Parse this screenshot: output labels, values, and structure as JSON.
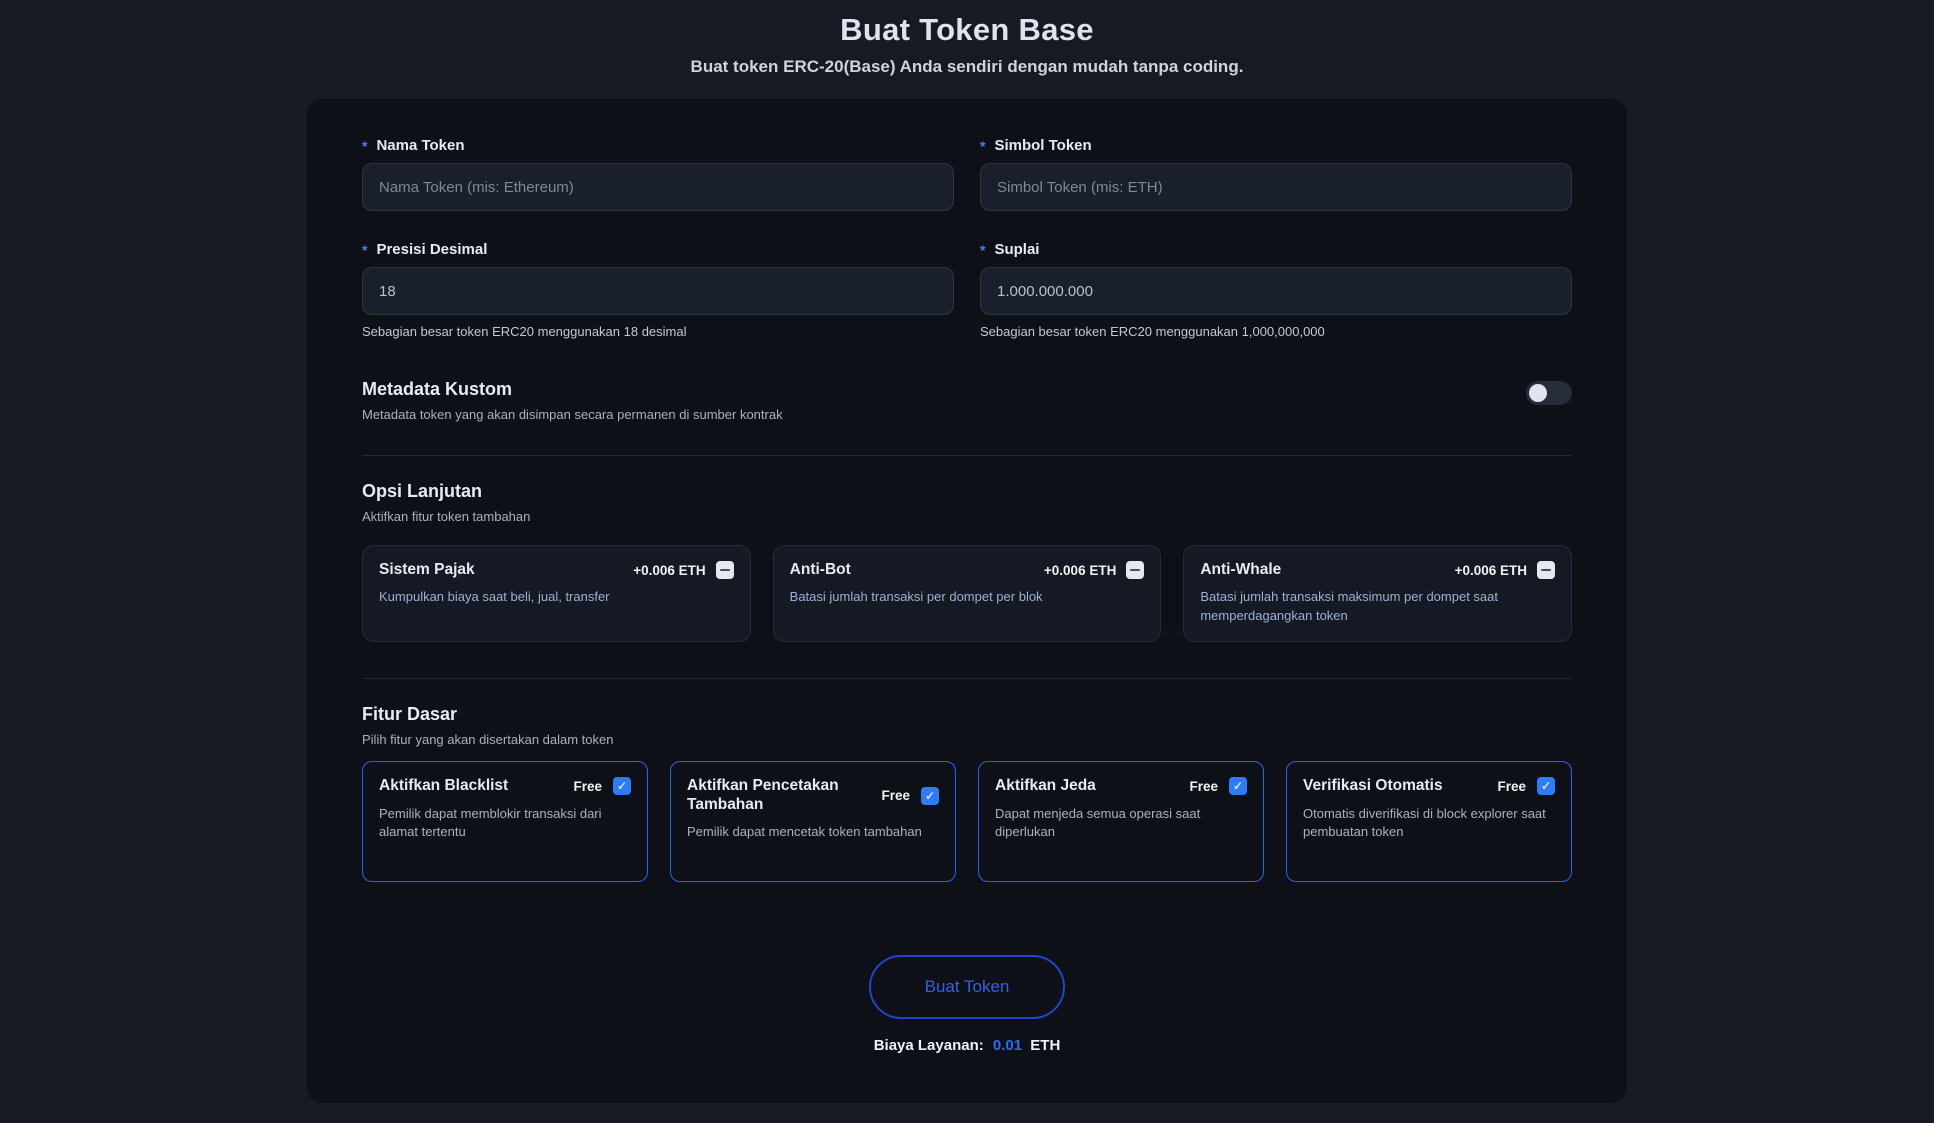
{
  "page": {
    "title": "Buat Token Base",
    "subtitle": "Buat token ERC-20(Base) Anda sendiri dengan mudah tanpa coding."
  },
  "icons": {
    "minus": "",
    "check": "✓"
  },
  "required_marker": "*",
  "form": {
    "fields": [
      {
        "label": "Nama Token",
        "required": true,
        "placeholder": "Nama Token (mis: Ethereum)",
        "value": ""
      },
      {
        "label": "Simbol Token",
        "required": true,
        "placeholder": "Simbol Token (mis: ETH)",
        "value": ""
      },
      {
        "label": "Presisi Desimal",
        "required": true,
        "placeholder": "",
        "value": "18",
        "helper": "Sebagian besar token ERC20 menggunakan 18 desimal"
      },
      {
        "label": "Suplai",
        "required": true,
        "placeholder": "",
        "value": "1.000.000.000",
        "helper": "Sebagian besar token ERC20 menggunakan 1,000,000,000"
      }
    ],
    "metadata": {
      "title": "Metadata Kustom",
      "description": "Metadata token yang akan disimpan secara permanen di sumber kontrak",
      "toggle_state": "off"
    },
    "advanced": {
      "title": "Opsi Lanjutan",
      "subtitle": "Aktifkan fitur token tambahan",
      "options": [
        {
          "name": "Sistem Pajak",
          "price": "+0.006 ETH",
          "description": "Kumpulkan biaya saat beli, jual, transfer",
          "checked": false
        },
        {
          "name": "Anti-Bot",
          "price": "+0.006 ETH",
          "description": "Batasi jumlah transaksi per dompet per blok",
          "checked": false
        },
        {
          "name": "Anti-Whale",
          "price": "+0.006 ETH",
          "description": "Batasi jumlah transaksi maksimum per dompet saat memperdagangkan token",
          "checked": false
        }
      ]
    },
    "basic": {
      "title": "Fitur Dasar",
      "subtitle": "Pilih fitur yang akan disertakan dalam token",
      "features": [
        {
          "name": "Aktifkan Blacklist",
          "price": "Free",
          "description": "Pemilik dapat memblokir transaksi dari alamat tertentu",
          "checked": true
        },
        {
          "name": "Aktifkan Pencetakan Tambahan",
          "price": "Free",
          "description": "Pemilik dapat mencetak token tambahan",
          "checked": true
        },
        {
          "name": "Aktifkan Jeda",
          "price": "Free",
          "description": "Dapat menjeda semua operasi saat diperlukan",
          "checked": true
        },
        {
          "name": "Verifikasi Otomatis",
          "price": "Free",
          "description": "Otomatis diverifikasi di block explorer saat pembuatan token",
          "checked": true
        }
      ]
    },
    "submit": {
      "label": "Buat Token",
      "fee_label": "Biaya Layanan:",
      "fee_value": "0.01",
      "fee_unit": "ETH"
    }
  },
  "colors": {
    "page_background": "#151a23",
    "card_background": "#0d1016",
    "accent_blue": "#3b82f6",
    "feature_border_blue": "#2563eb",
    "checkbox_blue": "#2e7cf6",
    "button_blue": "#2743c9",
    "fee_blue": "#2b6bf3"
  }
}
